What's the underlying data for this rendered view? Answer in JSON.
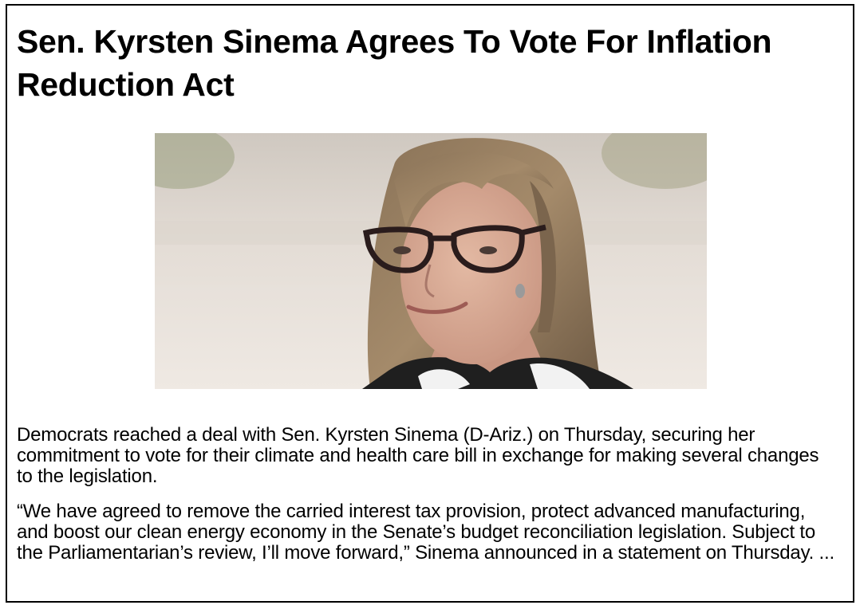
{
  "article": {
    "headline": "Sen. Kyrsten Sinema Agrees To Vote For Inflation Reduction Act",
    "paragraphs": [
      "Democrats reached a deal with Sen. Kyrsten Sinema (D-Ariz.) on Thursday, securing her commitment to vote for their climate and health care bill in exchange for making several changes to the legislation.",
      "“We have agreed to remove the carried interest tax provision, protect advanced manufacturing, and boost our clean energy economy in the Senate’s budget reconciliation legislation. Subject to the Parliamentarian’s review, I’ll move forward,” Sinema announced in a statement on Thursday. ..."
    ]
  },
  "colors": {
    "border": "#000000",
    "text": "#000000",
    "background": "#ffffff"
  }
}
